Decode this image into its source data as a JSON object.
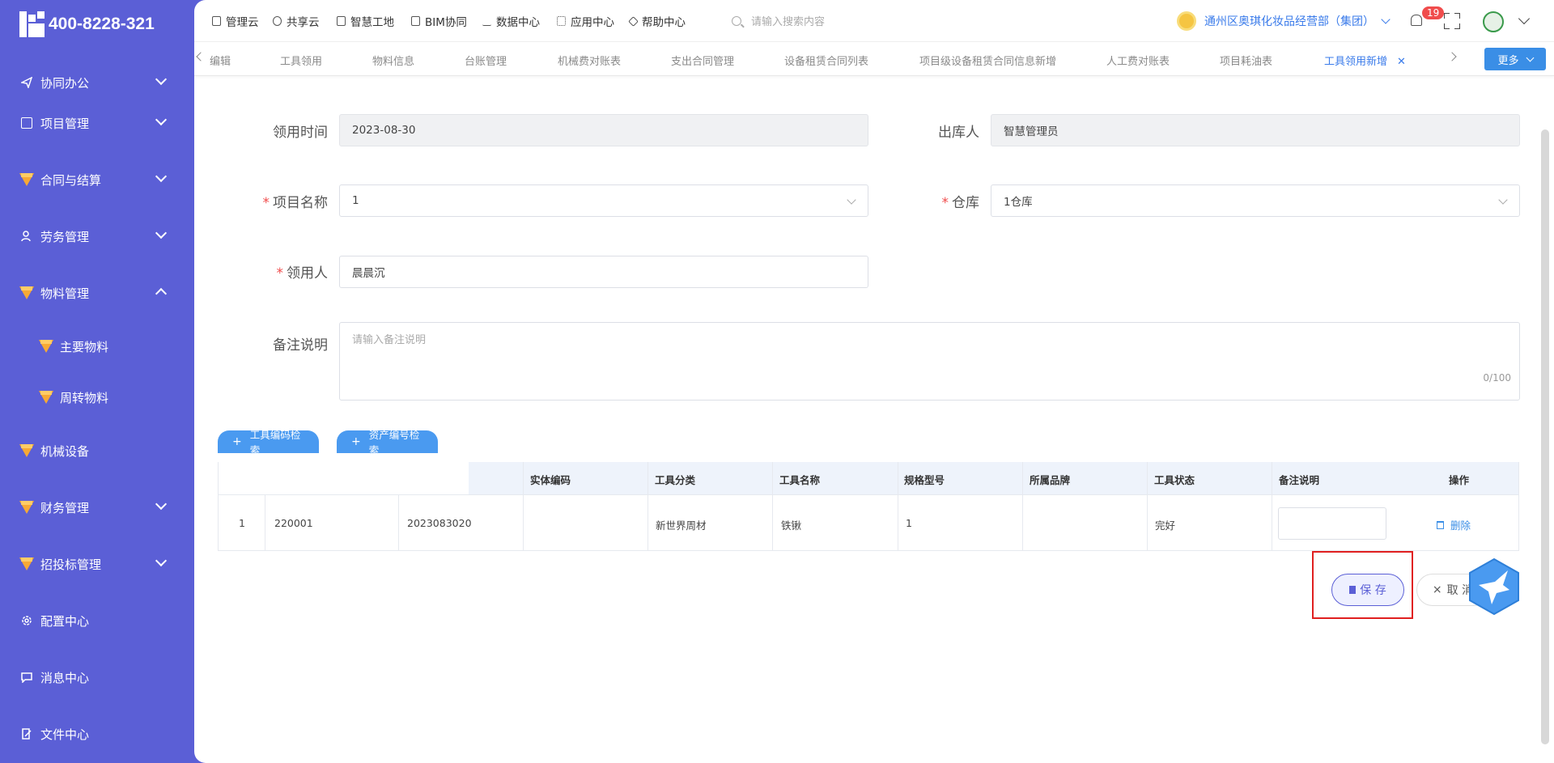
{
  "brand": {
    "phone": "400-8228-321"
  },
  "sidebar": {
    "items": [
      {
        "label": "协同办公",
        "icon": "send-icon",
        "expanded": false
      },
      {
        "label": "项目管理",
        "icon": "book-icon",
        "expanded": false
      },
      {
        "label": "合同与结算",
        "icon": "diamond-icon",
        "expanded": false
      },
      {
        "label": "劳务管理",
        "icon": "users-icon",
        "expanded": false
      },
      {
        "label": "物料管理",
        "icon": "diamond-icon",
        "expanded": true
      },
      {
        "label": "主要物料",
        "icon": "diamond-icon"
      },
      {
        "label": "周转物料",
        "icon": "diamond-icon"
      },
      {
        "label": "机械设备",
        "icon": "diamond-icon"
      },
      {
        "label": "财务管理",
        "icon": "diamond-icon",
        "expanded": false
      },
      {
        "label": "招投标管理",
        "icon": "diamond-icon",
        "expanded": false
      },
      {
        "label": "配置中心",
        "icon": "gear-icon"
      },
      {
        "label": "消息中心",
        "icon": "message-icon"
      },
      {
        "label": "文件中心",
        "icon": "file-edit-icon"
      }
    ]
  },
  "topbar": {
    "nav": [
      "管理云",
      "共享云",
      "智慧工地",
      "BIM协同",
      "数据中心",
      "应用中心",
      "帮助中心"
    ],
    "search_placeholder": "请输入搜索内容",
    "org": "通州区奥琪化妆品经营部（集团）",
    "notifications": "19"
  },
  "tabs": {
    "items": [
      "编辑",
      "工具领用",
      "物料信息",
      "台账管理",
      "机械费对账表",
      "支出合同管理",
      "设备租赁合同列表",
      "项目级设备租赁合同信息新增",
      "人工费对账表",
      "项目耗油表",
      "工具领用新增"
    ],
    "active_index": 10,
    "more_label": "更多"
  },
  "form": {
    "issue_time_label": "领用时间",
    "issue_time_value": "2023-08-30",
    "outbound_label": "出库人",
    "outbound_value": "智慧管理员",
    "project_label": "项目名称",
    "project_value": "1",
    "warehouse_label": "仓库",
    "warehouse_value": "1仓库",
    "receiver_label": "领用人",
    "receiver_value": "晨晨沉",
    "remark_label": "备注说明",
    "remark_placeholder": "请输入备注说明",
    "remark_count": "0/100",
    "required_mark": "*"
  },
  "buttons": {
    "tool_code_search": "工具编码检索",
    "asset_code_search": "资产编号检索",
    "save": "保 存",
    "cancel": "取 消",
    "delete": "删除"
  },
  "table": {
    "headers": [
      "实体编码",
      "工具分类",
      "工具名称",
      "规格型号",
      "所属品牌",
      "工具状态",
      "备注说明",
      "操作"
    ],
    "rows": [
      {
        "index": "1",
        "code": "220001",
        "asset_no": "2023083020",
        "entity_code": "",
        "category": "新世界周材",
        "name": "铁锹",
        "spec": "1",
        "brand": "",
        "status": "完好",
        "remark": ""
      }
    ]
  },
  "colors": {
    "sidebar": "#5b5fd6",
    "primary": "#3a8ee6",
    "highlight": "#e02020"
  }
}
